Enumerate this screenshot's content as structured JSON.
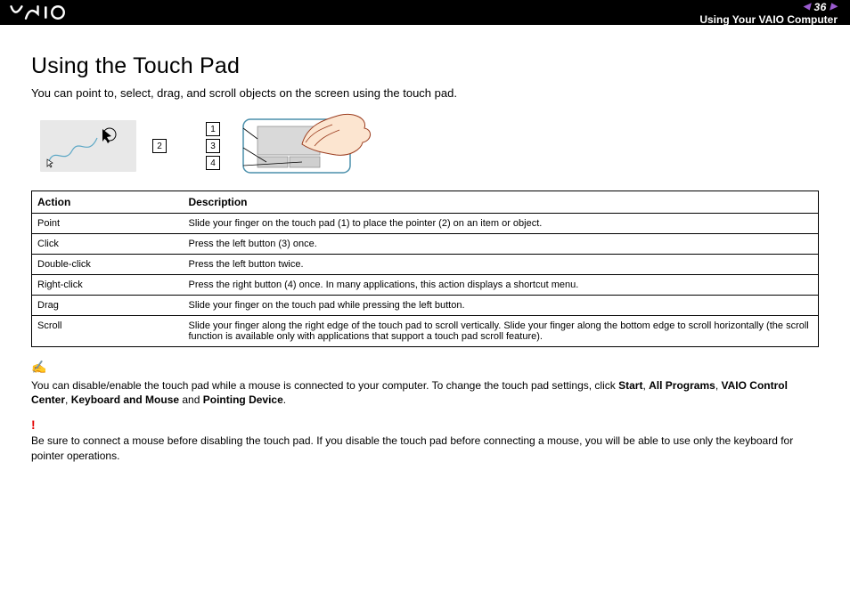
{
  "header": {
    "page_number": "36",
    "section": "Using Your VAIO Computer"
  },
  "title": "Using the Touch Pad",
  "intro": "You can point to, select, drag, and scroll objects on the screen using the touch pad.",
  "callouts": {
    "c1": "1",
    "c2": "2",
    "c3": "3",
    "c4": "4"
  },
  "table": {
    "head": {
      "action": "Action",
      "desc": "Description"
    },
    "rows": [
      {
        "action": "Point",
        "desc": "Slide your finger on the touch pad (1) to place the pointer (2) on an item or object."
      },
      {
        "action": "Click",
        "desc": "Press the left button (3) once."
      },
      {
        "action": "Double-click",
        "desc": "Press the left button twice."
      },
      {
        "action": "Right-click",
        "desc": "Press the right button (4) once. In many applications, this action displays a shortcut menu."
      },
      {
        "action": "Drag",
        "desc": "Slide your finger on the touch pad while pressing the left button."
      },
      {
        "action": "Scroll",
        "desc": "Slide your finger along the right edge of the touch pad to scroll vertically. Slide your finger along the bottom edge to scroll horizontally (the scroll function is available only with applications that support a touch pad scroll feature)."
      }
    ]
  },
  "note": {
    "prefix": "You can disable/enable the touch pad while a mouse is connected to your computer. To change the touch pad settings, click ",
    "b1": "Start",
    "s1": ", ",
    "b2": "All Programs",
    "s2": ", ",
    "b3": "VAIO Control Center",
    "s3": ", ",
    "b4": "Keyboard and Mouse",
    "s4": " and ",
    "b5": "Pointing Device",
    "s5": "."
  },
  "warning": "Be sure to connect a mouse before disabling the touch pad. If you disable the touch pad before connecting a mouse, you will be able to use only the keyboard for pointer operations."
}
